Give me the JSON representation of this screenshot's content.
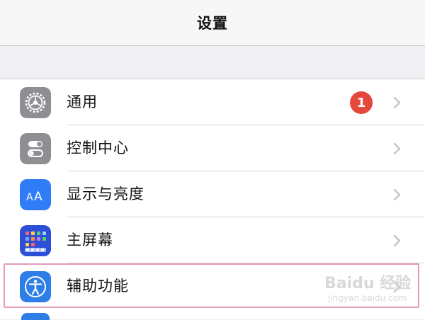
{
  "header": {
    "title": "设置"
  },
  "settings": {
    "items": [
      {
        "label": "通用",
        "icon": "gear-icon",
        "icon_bg": "#8e8e93",
        "badge": "1"
      },
      {
        "label": "控制中心",
        "icon": "toggle-switches-icon",
        "icon_bg": "#8e8e93"
      },
      {
        "label": "显示与亮度",
        "icon": "text-size-icon",
        "icon_bg": "#2f7cf6"
      },
      {
        "label": "主屏幕",
        "icon": "home-screen-grid-icon",
        "icon_bg": "#2c4fd6"
      },
      {
        "label": "辅助功能",
        "icon": "accessibility-person-icon",
        "icon_bg": "#2d7ee6"
      }
    ]
  },
  "colors": {
    "badge": "#e5473d",
    "highlight_border": "#e59ab9"
  },
  "watermark": {
    "main": "Baidu 经验",
    "sub": "jingyan.baidu.com"
  }
}
